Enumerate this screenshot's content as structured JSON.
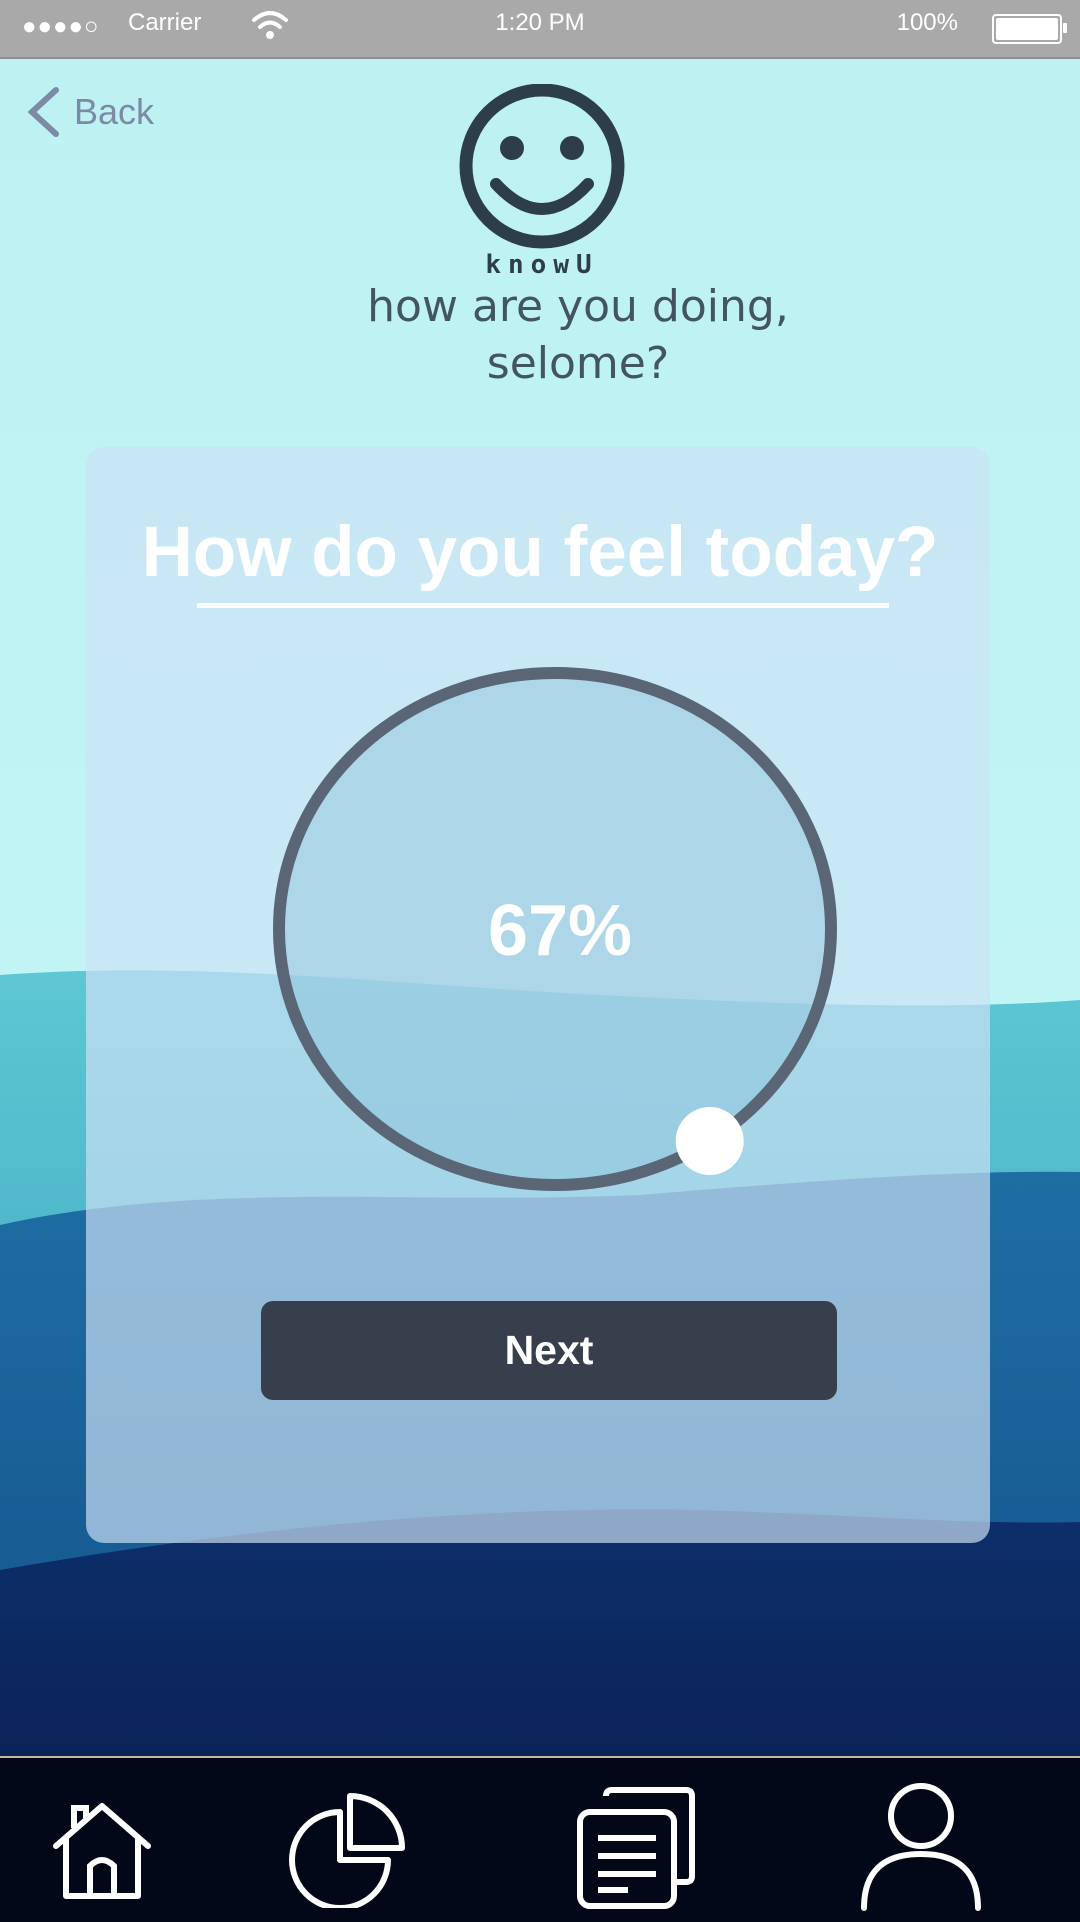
{
  "status_bar": {
    "carrier": "Carrier",
    "time": "1:20 PM",
    "battery": "100%"
  },
  "nav": {
    "back_label": "Back"
  },
  "logo": {
    "brand": "knowU"
  },
  "greeting": {
    "line1": "how are you doing,",
    "line2": "selome?"
  },
  "card": {
    "title": "How do you feel today?",
    "dial_value": "67%",
    "dial_fraction": 0.67,
    "next_label": "Next"
  },
  "tab_bar": {
    "items": [
      {
        "icon": "home-icon"
      },
      {
        "icon": "pie-chart-icon"
      },
      {
        "icon": "documents-icon"
      },
      {
        "icon": "profile-icon"
      }
    ]
  },
  "colors": {
    "sky": "#bff5f5",
    "ocean_deep": "#0a1b4d",
    "button": "#363f4b",
    "tab_bar": "#020818",
    "text_dark": "#425561"
  }
}
